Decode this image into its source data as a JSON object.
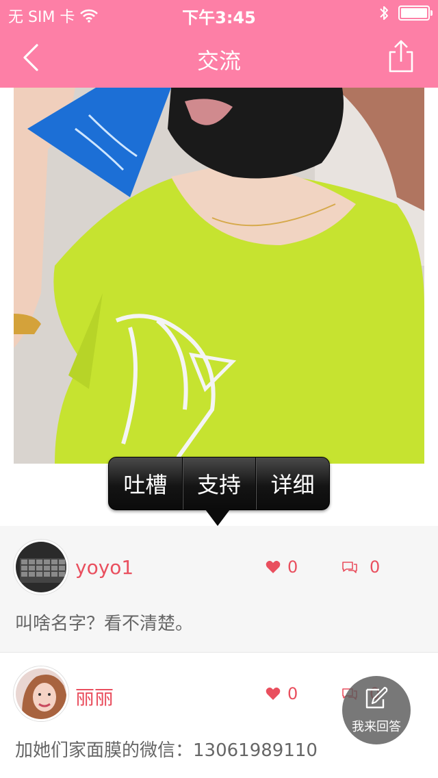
{
  "status_bar": {
    "carrier": "无 SIM 卡",
    "time": "下午3:45"
  },
  "nav": {
    "title": "交流"
  },
  "popup_menu": {
    "items": [
      "吐槽",
      "支持",
      "详细"
    ]
  },
  "comments": [
    {
      "username": "yoyo1",
      "likes": "0",
      "replies": "0",
      "text": "叫啥名字？看不清楚。"
    },
    {
      "username": "丽丽",
      "likes": "0",
      "replies": "0",
      "text": "加她们家面膜的微信：13061989110"
    }
  ],
  "answer_button": {
    "label": "我来回答"
  },
  "colors": {
    "header_pink": "#fd7fa6",
    "accent_red": "#e94f5e"
  }
}
